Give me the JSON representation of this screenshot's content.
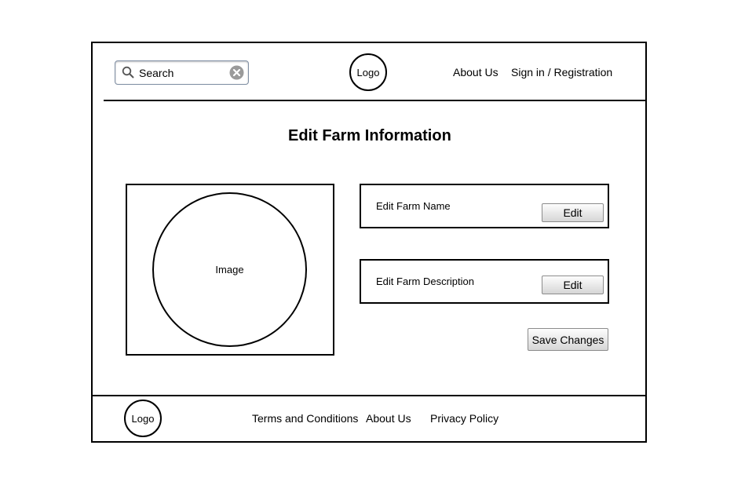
{
  "header": {
    "search": {
      "placeholder": "Search"
    },
    "logo": "Logo",
    "nav": {
      "about": "About Us",
      "signin": "Sign in / Registration"
    }
  },
  "main": {
    "title": "Edit Farm Information",
    "image_label": "Image",
    "fields": {
      "name": {
        "label": "Edit Farm Name",
        "button": "Edit"
      },
      "description": {
        "label": "Edit Farm Description",
        "button": "Edit"
      }
    },
    "save_button": "Save Changes"
  },
  "footer": {
    "logo": "Logo",
    "links": {
      "terms": "Terms and Conditions",
      "about": "About Us",
      "privacy": "Privacy Policy"
    }
  }
}
